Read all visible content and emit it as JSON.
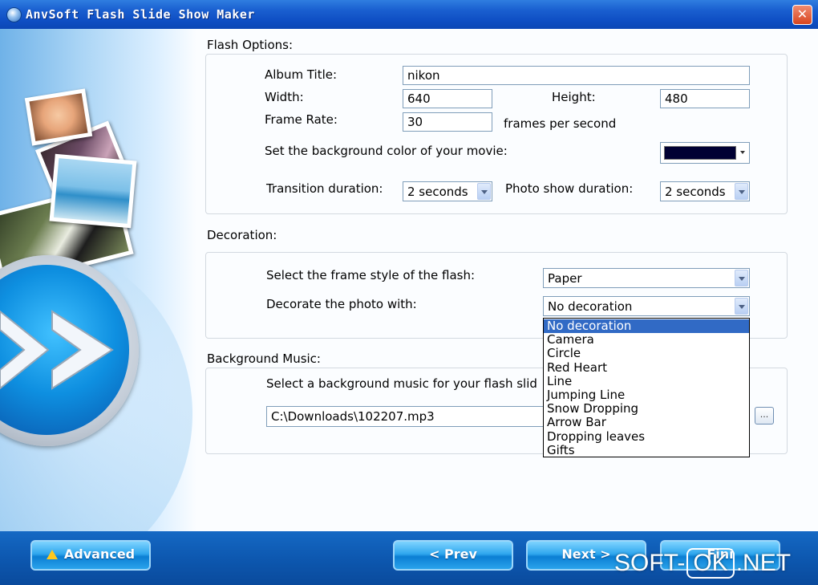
{
  "window": {
    "title": "AnvSoft Flash Slide Show Maker",
    "close_glyph": "✕"
  },
  "flash_options": {
    "section_label": "Flash Options:",
    "album_title_label": "Album Title:",
    "album_title_value": "nikon",
    "width_label": "Width:",
    "width_value": "640",
    "height_label": "Height:",
    "height_value": "480",
    "frame_rate_label": "Frame Rate:",
    "frame_rate_value": "30",
    "frame_rate_unit": "frames per second",
    "bg_color_label": "Set the background color of your movie:",
    "bg_color_value": "#000033",
    "transition_label": "Transition duration:",
    "transition_value": "2 seconds",
    "photo_show_label": "Photo show duration:",
    "photo_show_value": "2 seconds"
  },
  "decoration": {
    "section_label": "Decoration:",
    "frame_style_label": "Select the frame style of the flash:",
    "frame_style_value": "Paper",
    "decorate_label": "Decorate the photo with:",
    "decorate_value": "No decoration",
    "options": [
      "No decoration",
      "Camera",
      "Circle",
      "Red Heart",
      "Line",
      "Jumping Line",
      "Snow Dropping",
      "Arrow Bar",
      "Dropping leaves",
      "Gifts"
    ],
    "selected_index": 0
  },
  "music": {
    "section_label": "Background Music:",
    "select_label": "Select a background music for your flash slid",
    "path_value": "C:\\Downloads\\102207.mp3",
    "browse_label": "..."
  },
  "footer": {
    "advanced_label": "Advanced",
    "prev_label": "< Prev",
    "next_label": "Next >",
    "finish_label": "Fini"
  },
  "watermark": {
    "part1": "SOFT-",
    "part2": "OK",
    "part3": ".NET"
  },
  "colors": {
    "title_bar": "#1a5fd0",
    "bottom_bar": "#0d58b0",
    "selection": "#316ac5",
    "button": "#2fa7ee"
  }
}
